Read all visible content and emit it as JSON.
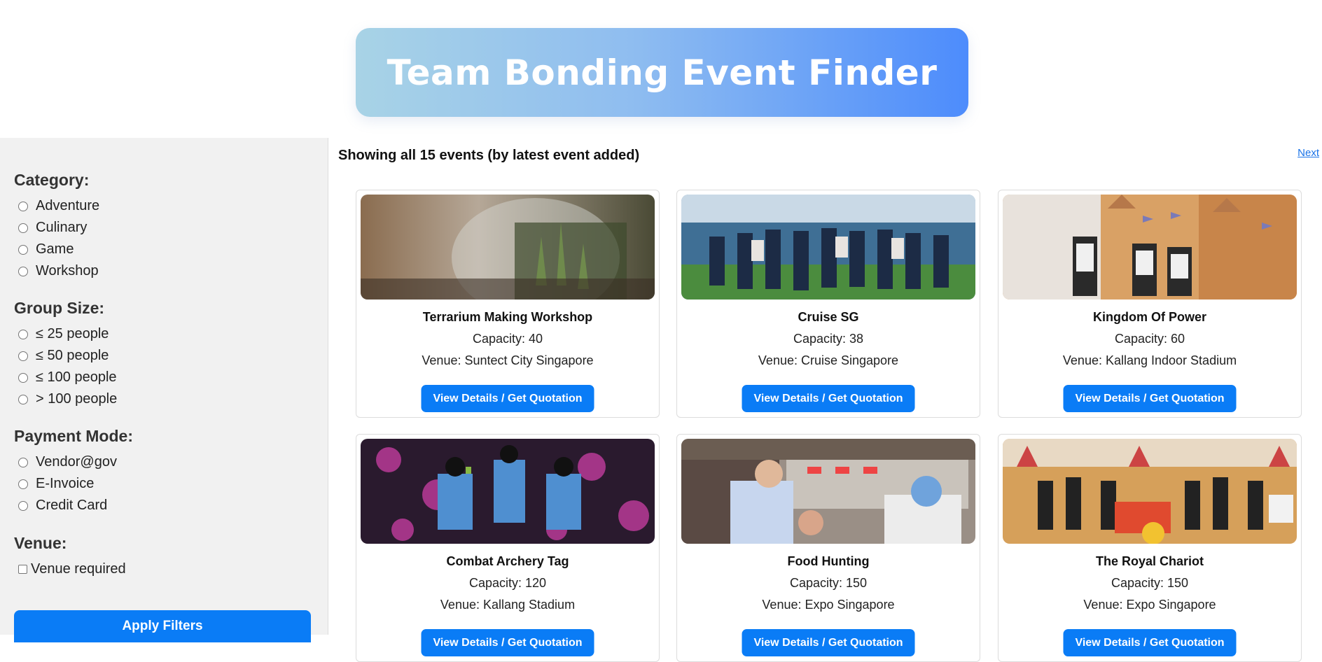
{
  "header": {
    "title": "Team Bonding Event Finder"
  },
  "filters": {
    "category": {
      "title": "Category:",
      "options": [
        "Adventure",
        "Culinary",
        "Game",
        "Workshop"
      ]
    },
    "group_size": {
      "title": "Group Size:",
      "options": [
        "≤ 25 people",
        "≤ 50 people",
        "≤ 100 people",
        "> 100 people"
      ]
    },
    "payment": {
      "title": "Payment Mode:",
      "options": [
        "Vendor@gov",
        "E-Invoice",
        "Credit Card"
      ]
    },
    "venue": {
      "title": "Venue:",
      "checkbox_label": "Venue required"
    },
    "apply_label": "Apply Filters"
  },
  "results": {
    "summary": "Showing all 15 events (by latest event added)",
    "next_label": "Next",
    "button_label": "View Details / Get Quotation",
    "events": [
      {
        "title": "Terrarium Making Workshop",
        "capacity": "Capacity: 40",
        "venue": "Venue: Suntect City Singapore"
      },
      {
        "title": "Cruise SG",
        "capacity": "Capacity: 38",
        "venue": "Venue: Cruise Singapore"
      },
      {
        "title": "Kingdom Of Power",
        "capacity": "Capacity: 60",
        "venue": "Venue: Kallang Indoor Stadium"
      },
      {
        "title": "Combat Archery Tag",
        "capacity": "Capacity: 120",
        "venue": "Venue: Kallang Stadium"
      },
      {
        "title": "Food Hunting",
        "capacity": "Capacity: 150",
        "venue": "Venue: Expo Singapore"
      },
      {
        "title": "The Royal Chariot",
        "capacity": "Capacity: 150",
        "venue": "Venue: Expo Singapore"
      }
    ]
  }
}
